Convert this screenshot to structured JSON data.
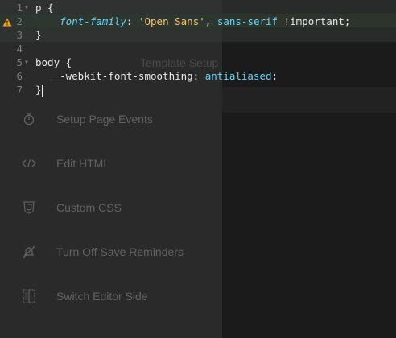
{
  "background_menu": {
    "tab_label": "Template Setup",
    "items": [
      {
        "icon": "stopwatch-icon",
        "label": "Setup Page Events"
      },
      {
        "icon": "code-brackets-icon",
        "label": "Edit HTML"
      },
      {
        "icon": "css3-icon",
        "label": "Custom CSS"
      },
      {
        "icon": "bell-off-icon",
        "label": "Turn Off Save Reminders"
      },
      {
        "icon": "switch-side-icon",
        "label": "Switch Editor Side"
      }
    ]
  },
  "editor": {
    "lines": [
      {
        "num": "1",
        "fold": "▾",
        "parts": [
          {
            "t": "p {",
            "c": "plain"
          }
        ]
      },
      {
        "num": "2",
        "fold": "",
        "warning": true,
        "parts": [
          {
            "t": "    ",
            "c": "plain"
          },
          {
            "t": "font-family",
            "c": "prop"
          },
          {
            "t": ": ",
            "c": "plain"
          },
          {
            "t": "'Open Sans'",
            "c": "string"
          },
          {
            "t": ", ",
            "c": "plain"
          },
          {
            "t": "sans-serif",
            "c": "keyword"
          },
          {
            "t": " !important;",
            "c": "plain"
          }
        ]
      },
      {
        "num": "3",
        "fold": "",
        "parts": [
          {
            "t": "}",
            "c": "plain"
          }
        ]
      },
      {
        "num": "4",
        "fold": "",
        "parts": []
      },
      {
        "num": "5",
        "fold": "▾",
        "parts": [
          {
            "t": "body {",
            "c": "plain"
          }
        ]
      },
      {
        "num": "6",
        "fold": "",
        "parts": [
          {
            "t": "    -webkit-font-smoothing: ",
            "c": "plain"
          },
          {
            "t": "antialiased",
            "c": "keyword"
          },
          {
            "t": ";",
            "c": "plain"
          }
        ]
      },
      {
        "num": "7",
        "fold": "",
        "parts": [
          {
            "t": "}",
            "c": "plain"
          }
        ],
        "cursor": true
      }
    ]
  },
  "colors": {
    "property": "#5fd7ff",
    "string": "#f5c26b",
    "warning": "#f0a020"
  }
}
